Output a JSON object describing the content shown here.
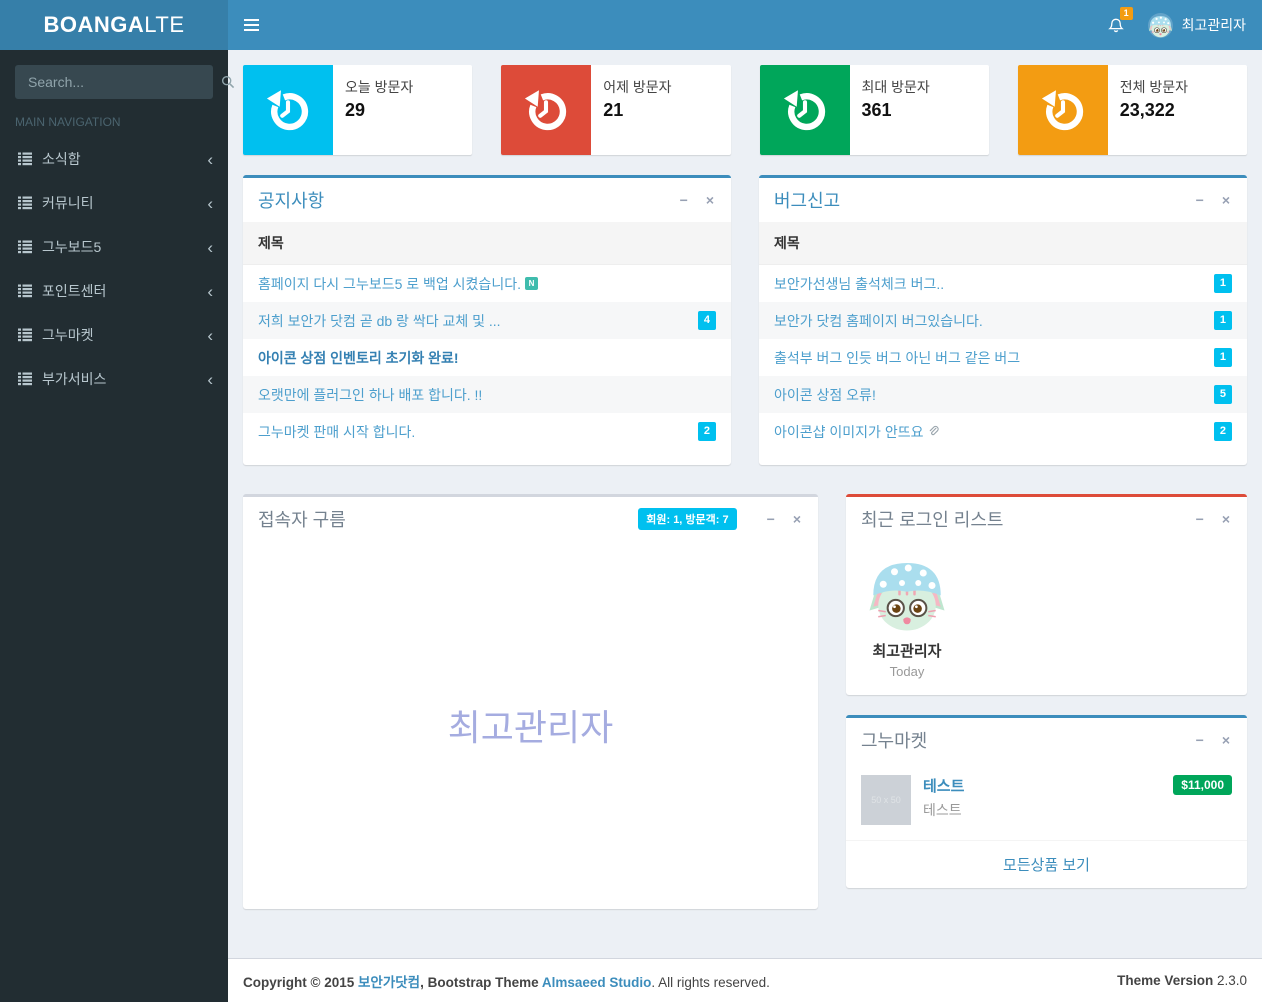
{
  "header": {
    "logo_bold": "BOANGA",
    "logo_light": "LTE",
    "notification_count": "1",
    "user_name": "최고관리자"
  },
  "sidebar": {
    "search_placeholder": "Search...",
    "nav_label": "MAIN NAVIGATION",
    "items": [
      {
        "label": "소식함"
      },
      {
        "label": "커뮤니티"
      },
      {
        "label": "그누보드5"
      },
      {
        "label": "포인트센터"
      },
      {
        "label": "그누마켓"
      },
      {
        "label": "부가서비스"
      }
    ]
  },
  "info_boxes": [
    {
      "label": "오늘 방문자",
      "value": "29",
      "color": "#00c0ef"
    },
    {
      "label": "어제 방문자",
      "value": "21",
      "color": "#dd4b39"
    },
    {
      "label": "최대 방문자",
      "value": "361",
      "color": "#00a65a"
    },
    {
      "label": "전체 방문자",
      "value": "23,322",
      "color": "#f39c12"
    }
  ],
  "notices": {
    "title": "공지사항",
    "column_header": "제목",
    "items": [
      {
        "text": "홈페이지 다시 그누보드5 로 백업 시켰습니다.",
        "new": true
      },
      {
        "text": "저희 보안가 닷컴 곧 db 랑 싹다 교체 및 ...",
        "badge": "4"
      },
      {
        "text": "아이콘 상점 인벤토리 초기화 완료!",
        "bold": true
      },
      {
        "text": "오랫만에 플러그인 하나 배포 합니다. !!"
      },
      {
        "text": "그누마켓 판매 시작 합니다.",
        "badge": "2"
      }
    ]
  },
  "bugs": {
    "title": "버그신고",
    "column_header": "제목",
    "items": [
      {
        "text": "보안가선생님 출석체크 버그..",
        "badge": "1"
      },
      {
        "text": "보안가 닷컴 홈페이지 버그있습니다.",
        "badge": "1"
      },
      {
        "text": "출석부 버그 인듯 버그 아닌 버그 같은 버그",
        "badge": "1"
      },
      {
        "text": "아이콘 상점 오류!",
        "badge": "5"
      },
      {
        "text": "아이콘샵 이미지가 안뜨요",
        "badge": "2",
        "attachment": true
      }
    ]
  },
  "visitors_cloud": {
    "title": "접속자 구름",
    "stats_badge": "회원: 1, 방문객: 7",
    "cloud_text": "최고관리자"
  },
  "recent_login": {
    "title": "최근 로그인 리스트",
    "user_name": "최고관리자",
    "login_time": "Today"
  },
  "market": {
    "title": "그누마켓",
    "product": {
      "name": "테스트",
      "description": "테스트",
      "price": "$11,000",
      "image_placeholder": "50 x 50"
    },
    "footer_link": "모든상품 보기"
  },
  "footer": {
    "prefix": "Copyright © 2015 ",
    "company": "보안가닷컴",
    "middle": ", Bootstrap Theme ",
    "studio": "Almsaeed Studio",
    "suffix": ". All rights reserved.",
    "theme_label": "Theme Version ",
    "theme_version": "2.3.0"
  },
  "icons": {
    "new_flag_glyph": "N",
    "minimize_glyph": "−",
    "close_glyph": "×",
    "chevron_glyph": "‹"
  },
  "colors": {
    "header_bar": "#3c8dbc",
    "logo_bg": "#367fa9",
    "sidebar_bg": "#222d32",
    "content_bg": "#ecf0f5",
    "badge_cyan": "#00c0ef",
    "badge_green": "#00a65a",
    "badge_orange": "#f39c12",
    "panel_red_border": "#dd4b39"
  }
}
